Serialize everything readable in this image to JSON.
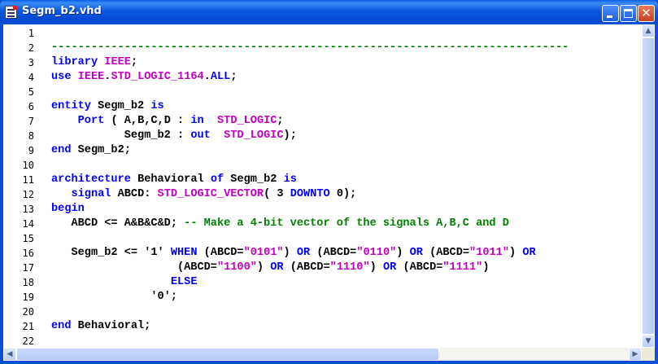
{
  "window": {
    "title": "Segm_b2.vhd"
  },
  "colors": {
    "keyword": "#0000ff",
    "literal": "#c200c2",
    "comment": "#008000"
  },
  "icons": {
    "app": "document-icon",
    "min": "minimize-icon",
    "max": "maximize-icon",
    "close": "close-icon",
    "close_glyph": "✕"
  },
  "line_numbers": [
    "1",
    "2",
    "3",
    "4",
    "5",
    "6",
    "7",
    "8",
    "9",
    "10",
    "11",
    "12",
    "13",
    "14",
    "15",
    "16",
    "17",
    "18",
    "19",
    "20",
    "21",
    "22"
  ],
  "code": [
    [],
    [
      {
        "t": "c",
        "v": "------------------------------------------------------------------------------"
      }
    ],
    [
      {
        "t": "k",
        "v": "library"
      },
      {
        "t": "p",
        "v": " "
      },
      {
        "t": "l",
        "v": "IEEE"
      },
      {
        "t": "p",
        "v": ";"
      }
    ],
    [
      {
        "t": "k",
        "v": "use"
      },
      {
        "t": "p",
        "v": " "
      },
      {
        "t": "l",
        "v": "IEEE"
      },
      {
        "t": "p",
        "v": "."
      },
      {
        "t": "l",
        "v": "STD_LOGIC_1164"
      },
      {
        "t": "p",
        "v": "."
      },
      {
        "t": "k",
        "v": "ALL"
      },
      {
        "t": "p",
        "v": ";"
      }
    ],
    [],
    [
      {
        "t": "k",
        "v": "entity"
      },
      {
        "t": "p",
        "v": " Segm_b2 "
      },
      {
        "t": "k",
        "v": "is"
      }
    ],
    [
      {
        "t": "p",
        "v": "    "
      },
      {
        "t": "k",
        "v": "Port"
      },
      {
        "t": "p",
        "v": " ( A,B,C,D : "
      },
      {
        "t": "k",
        "v": "in"
      },
      {
        "t": "p",
        "v": "  "
      },
      {
        "t": "l",
        "v": "STD_LOGIC"
      },
      {
        "t": "p",
        "v": ";"
      }
    ],
    [
      {
        "t": "p",
        "v": "           Segm_b2 : "
      },
      {
        "t": "k",
        "v": "out"
      },
      {
        "t": "p",
        "v": "  "
      },
      {
        "t": "l",
        "v": "STD_LOGIC"
      },
      {
        "t": "p",
        "v": ");"
      }
    ],
    [
      {
        "t": "k",
        "v": "end"
      },
      {
        "t": "p",
        "v": " Segm_b2;"
      }
    ],
    [],
    [
      {
        "t": "k",
        "v": "architecture"
      },
      {
        "t": "p",
        "v": " Behavioral "
      },
      {
        "t": "k",
        "v": "of"
      },
      {
        "t": "p",
        "v": " Segm_b2 "
      },
      {
        "t": "k",
        "v": "is"
      }
    ],
    [
      {
        "t": "p",
        "v": "   "
      },
      {
        "t": "k",
        "v": "signal"
      },
      {
        "t": "p",
        "v": " ABCD: "
      },
      {
        "t": "l",
        "v": "STD_LOGIC_VECTOR"
      },
      {
        "t": "p",
        "v": "( 3 "
      },
      {
        "t": "k",
        "v": "DOWNTO"
      },
      {
        "t": "p",
        "v": " 0);"
      }
    ],
    [
      {
        "t": "k",
        "v": "begin"
      }
    ],
    [
      {
        "t": "p",
        "v": "   ABCD <= A&B&C&D; "
      },
      {
        "t": "c",
        "v": "-- Make a 4-bit vector of the signals A,B,C and D"
      }
    ],
    [],
    [
      {
        "t": "p",
        "v": "   Segm_b2 <= '1' "
      },
      {
        "t": "k",
        "v": "WHEN"
      },
      {
        "t": "p",
        "v": " (ABCD="
      },
      {
        "t": "l",
        "v": "\"0101\""
      },
      {
        "t": "p",
        "v": ") "
      },
      {
        "t": "k",
        "v": "OR"
      },
      {
        "t": "p",
        "v": " (ABCD="
      },
      {
        "t": "l",
        "v": "\"0110\""
      },
      {
        "t": "p",
        "v": ") "
      },
      {
        "t": "k",
        "v": "OR"
      },
      {
        "t": "p",
        "v": " (ABCD="
      },
      {
        "t": "l",
        "v": "\"1011\""
      },
      {
        "t": "p",
        "v": ") "
      },
      {
        "t": "k",
        "v": "OR"
      }
    ],
    [
      {
        "t": "p",
        "v": "                   (ABCD="
      },
      {
        "t": "l",
        "v": "\"1100\""
      },
      {
        "t": "p",
        "v": ") "
      },
      {
        "t": "k",
        "v": "OR"
      },
      {
        "t": "p",
        "v": " (ABCD="
      },
      {
        "t": "l",
        "v": "\"1110\""
      },
      {
        "t": "p",
        "v": ") "
      },
      {
        "t": "k",
        "v": "OR"
      },
      {
        "t": "p",
        "v": " (ABCD="
      },
      {
        "t": "l",
        "v": "\"1111\""
      },
      {
        "t": "p",
        "v": ")"
      }
    ],
    [
      {
        "t": "p",
        "v": "                  "
      },
      {
        "t": "k",
        "v": "ELSE"
      }
    ],
    [
      {
        "t": "p",
        "v": "               '0';"
      }
    ],
    [],
    [
      {
        "t": "k",
        "v": "end"
      },
      {
        "t": "p",
        "v": " Behavioral;"
      }
    ],
    []
  ]
}
